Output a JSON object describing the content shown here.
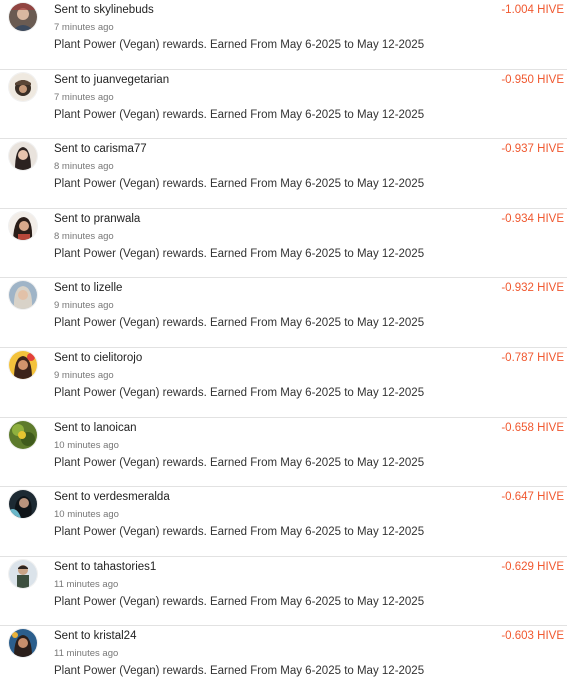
{
  "colors": {
    "amount": "#f0582f",
    "divider": "#e2e2e2",
    "time": "#777777"
  },
  "transfers": [
    {
      "prefix": "Sent to",
      "user": "skylinebuds",
      "time": "7 minutes ago",
      "memo": "Plant Power (Vegan) rewards. Earned From May 6-2025 to May 12-2025",
      "amount": "-1.004 HIVE",
      "avatar_icon": "avatar-photo-icon"
    },
    {
      "prefix": "Sent to",
      "user": "juanvegetarian",
      "time": "7 minutes ago",
      "memo": "Plant Power (Vegan) rewards. Earned From May 6-2025 to May 12-2025",
      "amount": "-0.950 HIVE",
      "avatar_icon": "avatar-photo-icon"
    },
    {
      "prefix": "Sent to",
      "user": "carisma77",
      "time": "8 minutes ago",
      "memo": "Plant Power (Vegan) rewards. Earned From May 6-2025 to May 12-2025",
      "amount": "-0.937 HIVE",
      "avatar_icon": "avatar-photo-icon"
    },
    {
      "prefix": "Sent to",
      "user": "pranwala",
      "time": "8 minutes ago",
      "memo": "Plant Power (Vegan) rewards. Earned From May 6-2025 to May 12-2025",
      "amount": "-0.934 HIVE",
      "avatar_icon": "avatar-photo-icon"
    },
    {
      "prefix": "Sent to",
      "user": "lizelle",
      "time": "9 minutes ago",
      "memo": "Plant Power (Vegan) rewards. Earned From May 6-2025 to May 12-2025",
      "amount": "-0.932 HIVE",
      "avatar_icon": "avatar-photo-icon"
    },
    {
      "prefix": "Sent to",
      "user": "cielitorojo",
      "time": "9 minutes ago",
      "memo": "Plant Power (Vegan) rewards. Earned From May 6-2025 to May 12-2025",
      "amount": "-0.787 HIVE",
      "avatar_icon": "avatar-photo-icon"
    },
    {
      "prefix": "Sent to",
      "user": "lanoican",
      "time": "10 minutes ago",
      "memo": "Plant Power (Vegan) rewards. Earned From May 6-2025 to May 12-2025",
      "amount": "-0.658 HIVE",
      "avatar_icon": "avatar-photo-icon"
    },
    {
      "prefix": "Sent to",
      "user": "verdesmeralda",
      "time": "10 minutes ago",
      "memo": "Plant Power (Vegan) rewards. Earned From May 6-2025 to May 12-2025",
      "amount": "-0.647 HIVE",
      "avatar_icon": "avatar-photo-icon"
    },
    {
      "prefix": "Sent to",
      "user": "tahastories1",
      "time": "11 minutes ago",
      "memo": "Plant Power (Vegan) rewards. Earned From May 6-2025 to May 12-2025",
      "amount": "-0.629 HIVE",
      "avatar_icon": "avatar-photo-icon"
    },
    {
      "prefix": "Sent to",
      "user": "kristal24",
      "time": "11 minutes ago",
      "memo": "Plant Power (Vegan) rewards. Earned From May 6-2025 to May 12-2025",
      "amount": "-0.603 HIVE",
      "avatar_icon": "avatar-photo-icon"
    }
  ]
}
